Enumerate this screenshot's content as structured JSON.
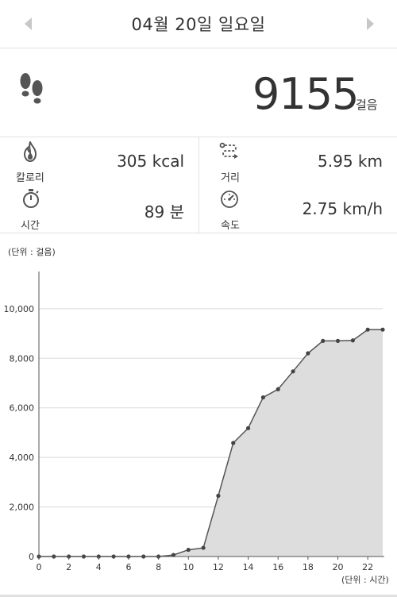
{
  "header": {
    "date": "04월 20일 일요일",
    "prev_icon": "chevron-left-icon",
    "next_icon": "chevron-right-icon"
  },
  "steps": {
    "count": "9155",
    "unit": "걸음",
    "icon": "footprints-icon"
  },
  "stats": {
    "calories": {
      "label": "칼로리",
      "value": "305 kcal",
      "icon": "flame-icon"
    },
    "distance": {
      "label": "거리",
      "value": "5.95 km",
      "icon": "route-icon"
    },
    "time": {
      "label": "시간",
      "value": "89 분",
      "icon": "stopwatch-icon"
    },
    "speed": {
      "label": "속도",
      "value": "2.75 km/h",
      "icon": "speedometer-icon"
    }
  },
  "chart_labels": {
    "y_unit": "(단위 : 걸음)",
    "x_unit": "(단위 : 시간)"
  },
  "chart_data": {
    "type": "area",
    "title": "",
    "xlabel": "(단위 : 시간)",
    "ylabel": "(단위 : 걸음)",
    "x": [
      0,
      1,
      2,
      3,
      4,
      5,
      6,
      7,
      8,
      9,
      10,
      11,
      12,
      13,
      14,
      15,
      16,
      17,
      18,
      19,
      20,
      21,
      22,
      23
    ],
    "values": [
      0,
      0,
      0,
      0,
      0,
      0,
      0,
      0,
      0,
      60,
      270,
      350,
      2450,
      4580,
      5180,
      6420,
      6750,
      7470,
      8200,
      8700,
      8700,
      8720,
      9155,
      9155
    ],
    "xticks": [
      0,
      2,
      4,
      6,
      8,
      10,
      12,
      14,
      16,
      18,
      20,
      22
    ],
    "xticklabels": [
      "0",
      "2",
      "4",
      "6",
      "8",
      "10",
      "12",
      "14",
      "16",
      "18",
      "20",
      "22"
    ],
    "yticks": [
      0,
      2000,
      4000,
      6000,
      8000,
      10000
    ],
    "yticklabels": [
      "0",
      "2,000",
      "4,000",
      "6,000",
      "8,000",
      "10,000"
    ],
    "xlim": [
      0,
      23
    ],
    "ylim": [
      0,
      11500
    ],
    "grid": true,
    "fill_color": "#dedddd",
    "line_color": "#555555"
  }
}
